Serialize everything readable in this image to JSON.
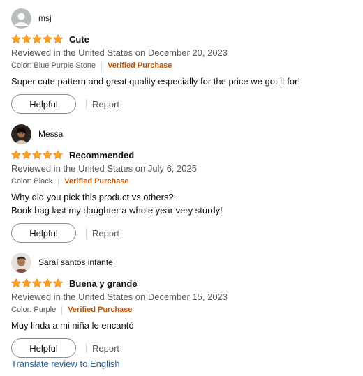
{
  "colors": {
    "star": "#ffa41c",
    "verified": "#c45500",
    "link": "#2162a1",
    "muted": "#565959"
  },
  "reviews": [
    {
      "reviewer": "msj",
      "avatar": "default-avatar",
      "rating": 5,
      "title": "Cute",
      "date": "Reviewed in the United States on December 20, 2023",
      "color_label": "Color: Blue Purple Stone",
      "verified": "Verified Purchase",
      "body": [
        "Super cute pattern and great quality especially for the price we got it for!"
      ],
      "helpful": "Helpful",
      "report": "Report"
    },
    {
      "reviewer": "Messa",
      "avatar": "photo-avatar",
      "rating": 5,
      "title": "Recommended",
      "date": "Reviewed in the United States on July 6, 2025",
      "color_label": "Color: Black",
      "verified": "Verified Purchase",
      "body": [
        "Why did you pick this product vs others?:",
        "Book bag last my daughter a whole year very sturdy!"
      ],
      "helpful": "Helpful",
      "report": "Report"
    },
    {
      "reviewer": "Saraí santos infante",
      "avatar": "photo-avatar",
      "rating": 5,
      "title": "Buena y grande",
      "date": "Reviewed in the United States on December 15, 2023",
      "color_label": "Color: Purple",
      "verified": "Verified Purchase",
      "body": [
        "Muy linda a mi niña le encantó"
      ],
      "helpful": "Helpful",
      "report": "Report"
    }
  ],
  "translate_link": "Translate review to English"
}
